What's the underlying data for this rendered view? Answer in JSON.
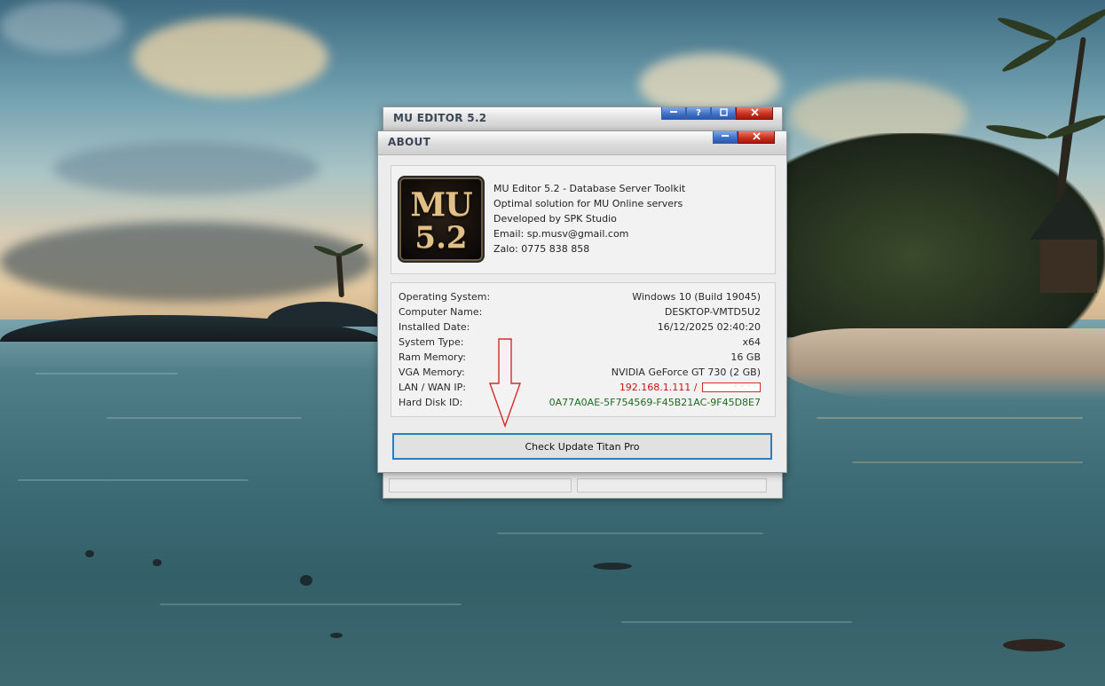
{
  "main_window": {
    "title": "MU EDITOR 5.2",
    "help_glyph": "?"
  },
  "about_dialog": {
    "title": "ABOUT",
    "logo": {
      "line1": "MU",
      "line2": "5.2"
    },
    "info": {
      "line1": "MU Editor 5.2 - Database  Server Toolkit",
      "line2": "Optimal solution for MU Online servers",
      "line3": "Developed by SPK Studio",
      "line4": "Email: sp.musv@gmail.com",
      "line5": "Zalo: 0775 838 858"
    },
    "specs": [
      {
        "label": "Operating System:",
        "value": "Windows 10 (Build 19045)"
      },
      {
        "label": "Computer Name:",
        "value": "DESKTOP-VMTD5U2"
      },
      {
        "label": "Installed Date:",
        "value": "16/12/2025 02:40:20"
      },
      {
        "label": "System Type:",
        "value": "x64"
      },
      {
        "label": "Ram Memory:",
        "value": "16 GB"
      },
      {
        "label": "VGA Memory:",
        "value": "NVIDIA GeForce GT 730 (2 GB)"
      },
      {
        "label": "LAN / WAN IP:",
        "value": "192.168.1.111 /",
        "value_redacted": "*.*.*.*"
      },
      {
        "label": "Hard Disk ID:",
        "value": "0A77A0AE-5F754569-F45B21AC-9F45D8E7"
      }
    ],
    "update_button": "Check Update Titan Pro"
  },
  "colors": {
    "ip_text": "#c4161c",
    "disk_id_text": "#1e6b1e",
    "button_border": "#2b7dc4",
    "arrow_annotation": "#d62a2a"
  }
}
